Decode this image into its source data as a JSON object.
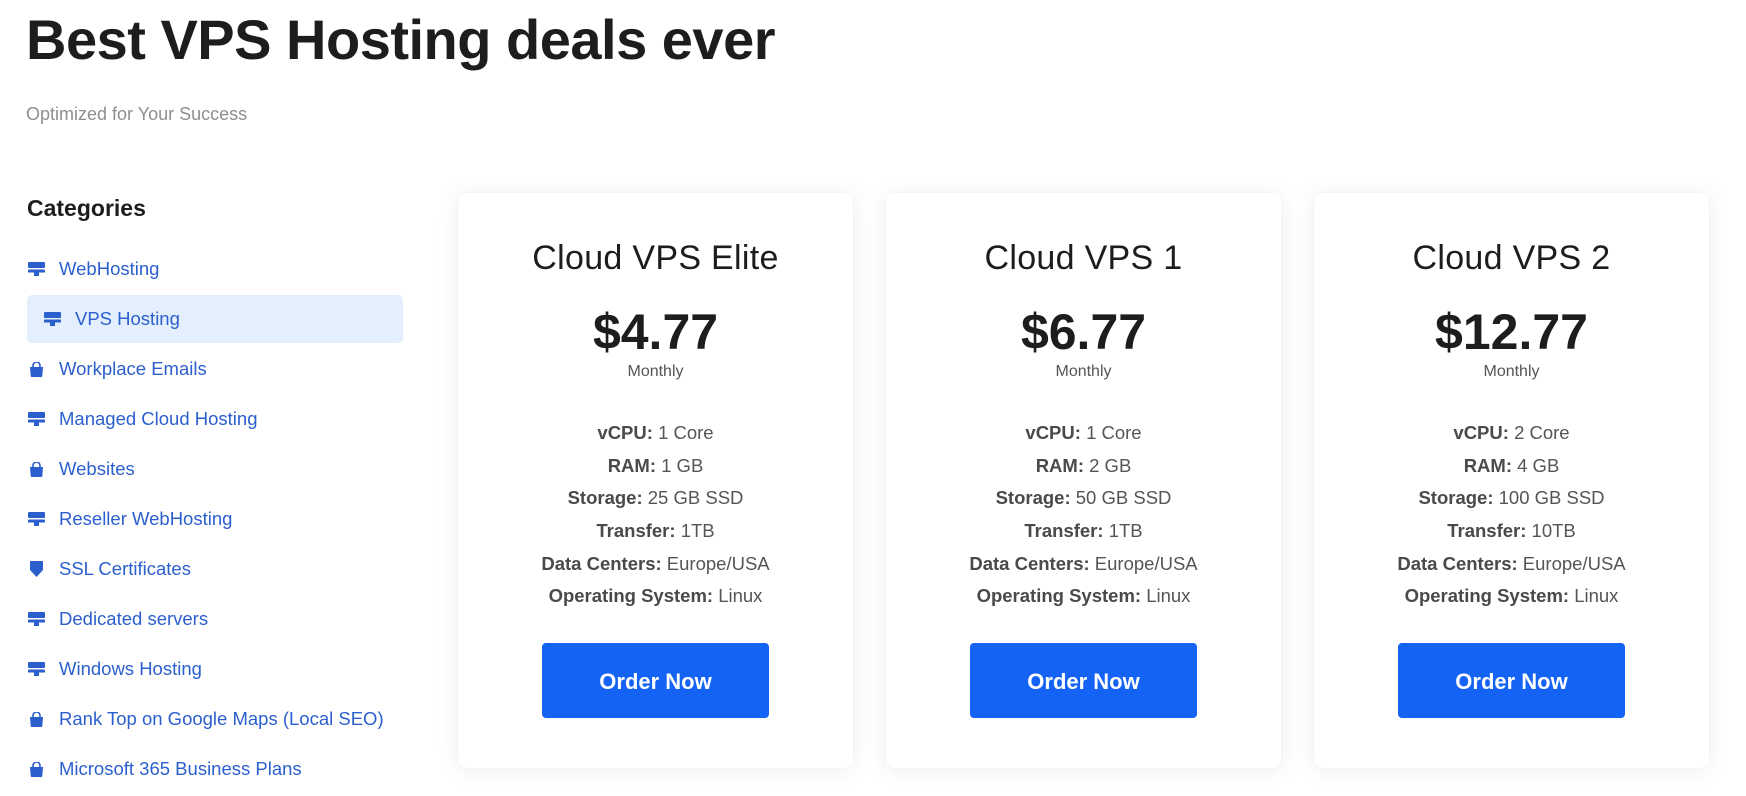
{
  "header": {
    "title": "Best VPS Hosting deals ever",
    "subtitle": "Optimized for Your Success"
  },
  "colors": {
    "accent": "#1463f5",
    "link": "#2b5fce",
    "active_bg": "#e3effd"
  },
  "sidebar": {
    "heading": "Categories",
    "items": [
      {
        "label": "WebHosting",
        "icon": "server-icon",
        "active": false
      },
      {
        "label": "VPS Hosting",
        "icon": "server-icon",
        "active": true
      },
      {
        "label": "Workplace Emails",
        "icon": "shopping-bag-icon",
        "active": false
      },
      {
        "label": "Managed Cloud Hosting",
        "icon": "server-icon",
        "active": false
      },
      {
        "label": "Websites",
        "icon": "shopping-bag-icon",
        "active": false
      },
      {
        "label": "Reseller WebHosting",
        "icon": "server-icon",
        "active": false
      },
      {
        "label": "SSL Certificates",
        "icon": "shield-icon",
        "active": false
      },
      {
        "label": "Dedicated servers",
        "icon": "server-icon",
        "active": false
      },
      {
        "label": "Windows Hosting",
        "icon": "server-icon",
        "active": false
      },
      {
        "label": "Rank Top on Google Maps (Local SEO)",
        "icon": "shopping-bag-icon",
        "active": false
      },
      {
        "label": "Microsoft 365 Business Plans",
        "icon": "shopping-bag-icon",
        "active": false
      }
    ]
  },
  "plans": [
    {
      "name": "Cloud VPS Elite",
      "price": "$4.77",
      "period": "Monthly",
      "specs": [
        {
          "label": "vCPU:",
          "value": "1 Core"
        },
        {
          "label": "RAM:",
          "value": "1 GB"
        },
        {
          "label": "Storage:",
          "value": "25 GB SSD"
        },
        {
          "label": "Transfer:",
          "value": "1TB"
        },
        {
          "label": "Data Centers:",
          "value": "Europe/USA"
        },
        {
          "label": "Operating System:",
          "value": "Linux"
        }
      ],
      "button": "Order Now"
    },
    {
      "name": "Cloud VPS 1",
      "price": "$6.77",
      "period": "Monthly",
      "specs": [
        {
          "label": "vCPU:",
          "value": "1 Core"
        },
        {
          "label": "RAM:",
          "value": "2 GB"
        },
        {
          "label": "Storage:",
          "value": "50 GB SSD"
        },
        {
          "label": "Transfer:",
          "value": "1TB"
        },
        {
          "label": "Data Centers:",
          "value": "Europe/USA"
        },
        {
          "label": "Operating System:",
          "value": "Linux"
        }
      ],
      "button": "Order Now"
    },
    {
      "name": "Cloud VPS 2",
      "price": "$12.77",
      "period": "Monthly",
      "specs": [
        {
          "label": "vCPU:",
          "value": "2 Core"
        },
        {
          "label": "RAM:",
          "value": "4 GB"
        },
        {
          "label": "Storage:",
          "value": "100 GB SSD"
        },
        {
          "label": "Transfer:",
          "value": "10TB"
        },
        {
          "label": "Data Centers:",
          "value": "Europe/USA"
        },
        {
          "label": "Operating System:",
          "value": "Linux"
        }
      ],
      "button": "Order Now"
    }
  ]
}
